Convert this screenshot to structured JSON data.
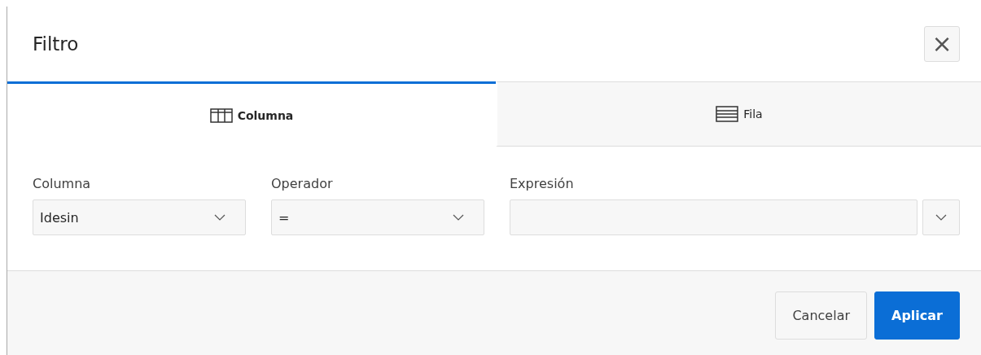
{
  "dialog": {
    "title": "Filtro",
    "close_label": "×"
  },
  "tabs": [
    {
      "label": "Columna",
      "kind": "columns",
      "selected": true
    },
    {
      "label": "Fila",
      "kind": "rows",
      "selected": false
    }
  ],
  "fields": [
    {
      "label": "Columna",
      "kind": "select",
      "value": "Idesin"
    },
    {
      "label": "Operador",
      "kind": "select",
      "value": "="
    },
    {
      "label": "Expresión",
      "kind": "combo"
    }
  ],
  "buttons": [
    {
      "label": "Cancelar",
      "kind": "default"
    },
    {
      "label": "Aplicar",
      "kind": "primary"
    }
  ]
}
